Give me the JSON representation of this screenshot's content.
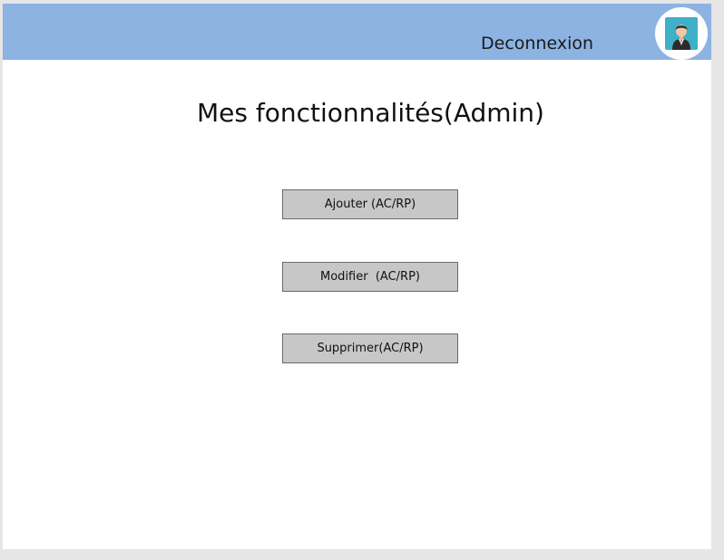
{
  "header": {
    "logout_label": "Deconnexion",
    "background_color": "#8db3e2",
    "avatar_icon": "user-avatar-icon"
  },
  "main": {
    "title": "Mes fonctionnalités(Admin)",
    "buttons": [
      {
        "label": "Ajouter (AC/RP)"
      },
      {
        "label": "Modifier  (AC/RP)"
      },
      {
        "label": "Supprimer(AC/RP)"
      }
    ]
  }
}
